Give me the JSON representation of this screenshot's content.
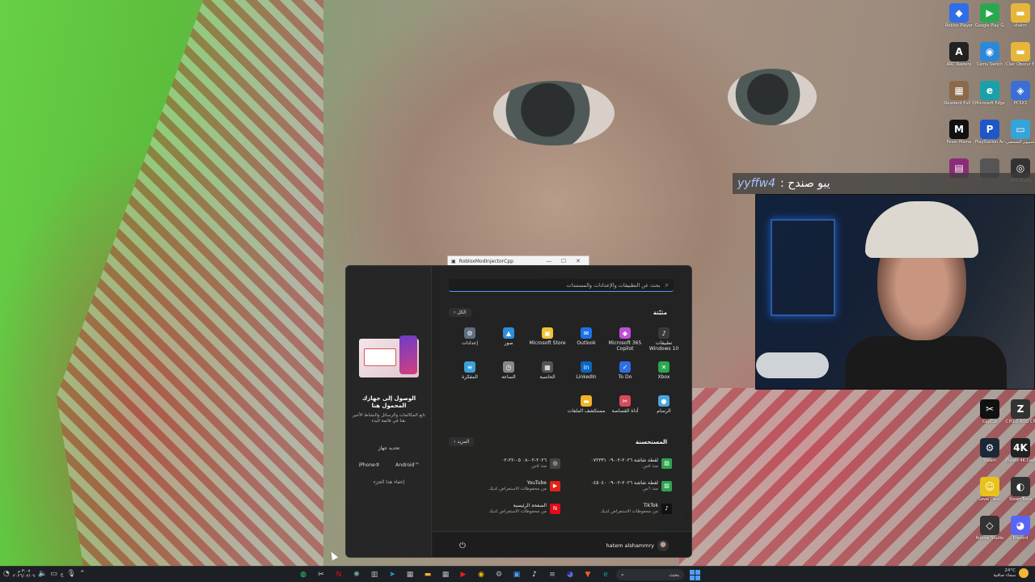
{
  "desktop_icons_right": [
    {
      "label": "Roblox Player",
      "icon": "roblox-icon",
      "color": "#2f6ee6"
    },
    {
      "label": "Google Play Games",
      "icon": "google-play-icon",
      "color": "#2aa84f"
    },
    {
      "label": "shatm",
      "icon": "folder-icon",
      "color": "#e5b63b"
    },
    {
      "label": "ARC Raiders",
      "icon": "arc-raiders-icon",
      "color": "#222222"
    },
    {
      "label": "Cemu Switch",
      "icon": "emulator-icon",
      "color": "#2c88d9"
    },
    {
      "label": "Clair Obscur Expedition 33",
      "icon": "folder-icon",
      "color": "#e5b63b"
    },
    {
      "label": "Resident Evil 7 Biohazard",
      "icon": "game-icon",
      "color": "#8a6a4a"
    },
    {
      "label": "Microsoft Edge",
      "icon": "edge-icon",
      "color": "#1aa0a8"
    },
    {
      "label": "PCSX2",
      "icon": "pcsx2-icon",
      "color": "#3b6fd6"
    },
    {
      "label": "Fever Meme",
      "icon": "fever-meme-icon",
      "color": "#111111"
    },
    {
      "label": "PlayStation Accessories",
      "icon": "playstation-icon",
      "color": "#1f56c9"
    },
    {
      "label": "هذا الكمبيوتر الشخصي",
      "icon": "computer-icon",
      "color": "#35a4d9"
    },
    {
      "label": "",
      "icon": "winrar-icon",
      "color": "#8a2c7a"
    },
    {
      "label": "",
      "icon": "",
      "color": "#555555"
    },
    {
      "label": "OBS Studio",
      "icon": "obs-icon",
      "color": "#333333"
    }
  ],
  "desktop_icons_right_lower": [
    {
      "label": "CapCut",
      "icon": "capcut-icon",
      "color": "#111111"
    },
    {
      "label": "CPUID ROG CPU-Z",
      "icon": "cpuz-icon",
      "color": "#333333"
    },
    {
      "label": "Steam",
      "icon": "steam-icon",
      "color": "#1b2838"
    },
    {
      "label": "Elgato 4K Capture",
      "icon": "elgato-icon",
      "color": "#222222"
    },
    {
      "label": "Level Devil",
      "icon": "level-devil-icon",
      "color": "#e8c21a"
    },
    {
      "label": "SteamTools",
      "icon": "steamtools-icon",
      "color": "#333333"
    },
    {
      "label": "Roblox Studio",
      "icon": "roblox-studio-icon",
      "color": "#333333"
    },
    {
      "label": "Discord",
      "icon": "discord-icon",
      "color": "#5865f2"
    }
  ],
  "donation": {
    "name": "yyffw4",
    "message": ": يبو صندح"
  },
  "mini_window": {
    "title": "RobloxModInjectorCpp",
    "minimize": "—",
    "maximize": "☐",
    "close": "✕"
  },
  "start_menu": {
    "search_placeholder": "بحث عن التطبيقات والإعدادات والمستندات",
    "pinned": {
      "title": "مثبّتة",
      "all_button": "الكل",
      "apps": [
        {
          "label": "تطبيقات Windows 10",
          "icon": "tiktok-icon",
          "color": "#3a3a3a"
        },
        {
          "label": "Microsoft 365 Copilot",
          "icon": "copilot-icon",
          "color": "#c14fd8"
        },
        {
          "label": "Outlook",
          "icon": "outlook-icon",
          "color": "#1a73e8"
        },
        {
          "label": "Microsoft Store",
          "icon": "store-icon",
          "color": "#f1c232"
        },
        {
          "label": "صور",
          "icon": "photos-icon",
          "color": "#2d8fdc"
        },
        {
          "label": "إعدادات",
          "icon": "settings-icon",
          "color": "#5f6f80"
        },
        {
          "label": "Xbox",
          "icon": "xbox-icon",
          "color": "#2aa84f"
        },
        {
          "label": "To Do",
          "icon": "todo-icon",
          "color": "#2f6ee6"
        },
        {
          "label": "LinkedIn",
          "icon": "linkedin-icon",
          "color": "#0a66c2"
        },
        {
          "label": "الحاسبة",
          "icon": "calculator-icon",
          "color": "#555555"
        },
        {
          "label": "الساعة",
          "icon": "clock-icon",
          "color": "#888888"
        },
        {
          "label": "المفكرة",
          "icon": "notepad-icon",
          "color": "#3aa0d8"
        },
        {
          "label": "الرسام",
          "icon": "paint-icon",
          "color": "#4ca3e0"
        },
        {
          "label": "أداة القصاصة",
          "icon": "snipping-tool-icon",
          "color": "#d84a5a"
        },
        {
          "label": "مستكشف الملفات",
          "icon": "file-explorer-icon",
          "color": "#f0b429"
        }
      ]
    },
    "recommended": {
      "title": "المستحسنة",
      "more_button": "المزيد",
      "items": [
        {
          "name": "لقطة شاشة ٢٠٢٦-٠٢-٠٩ ٠٧٢٣٣١",
          "sub": "منذ ٥س",
          "icon": "image-file-icon",
          "color": "#2ea44f"
        },
        {
          "name": "٢٠٢٦-٠٢-٠٨ ٠٥-٢٢-٠٢",
          "sub": "منذ ٥س",
          "icon": "obs-icon",
          "color": "#444444"
        },
        {
          "name": "لقطة شاشة ٢٠٢٦-٠٢-٠٩ ٠٤٥٠٤٠",
          "sub": "منذ ٦س",
          "icon": "image-file-icon",
          "color": "#2ea44f"
        },
        {
          "name": "YouTube",
          "sub": "من محفوظات الاستعراض لديك",
          "icon": "youtube-icon",
          "color": "#e62117"
        },
        {
          "name": "TikTok",
          "sub": "من محفوظات الاستعراض لديك",
          "icon": "tiktok-icon",
          "color": "#111111"
        },
        {
          "name": "الصفحة الرئيسية",
          "sub": "من محفوظات الاستعراض لديك",
          "icon": "netflix-icon",
          "color": "#e50914"
        }
      ]
    },
    "user_name": "hatem alshammry",
    "phone_pane": {
      "title": "الوصول إلى جهازك المحمول هنا",
      "description": "تابع المكالمات والرسائل والنشاط الأخير هنا في قائمة البدء.",
      "select_device": "تحديد جهاز",
      "iphone": "iPhone®",
      "android": "Android™",
      "hide": "إخفاء هذا الجزء"
    }
  },
  "taskbar": {
    "search_label": "بحث",
    "clock_time": "٣:٠٧ م",
    "clock_date": "٢٠٢٦/٠٢/٠٩",
    "lang": "ع",
    "weather_temp": "24°C",
    "weather_text": "سماء صافية",
    "apps": [
      {
        "icon": "whatsapp-icon",
        "color": "#25d366"
      },
      {
        "icon": "capcut-icon",
        "color": "#dddddd"
      },
      {
        "icon": "netflix-icon",
        "color": "#e50914"
      },
      {
        "icon": "chatgpt-icon",
        "color": "#74aa9c"
      },
      {
        "icon": "task-manager-icon",
        "color": "#bbbbbb"
      },
      {
        "icon": "telegram-icon",
        "color": "#2aa3e0"
      },
      {
        "icon": "calculator-icon",
        "color": "#bbbbbb"
      },
      {
        "icon": "file-explorer-icon",
        "color": "#f0b429"
      },
      {
        "icon": "calendar-icon",
        "color": "#bbbbbb"
      },
      {
        "icon": "youtube-icon",
        "color": "#e62117"
      },
      {
        "icon": "chrome-icon",
        "color": "#f4b400"
      },
      {
        "icon": "settings-icon",
        "color": "#bbbbbb"
      },
      {
        "icon": "store-icon",
        "color": "#4aa0ff"
      },
      {
        "icon": "tiktok-icon",
        "color": "#ffffff"
      },
      {
        "icon": "notepad-icon",
        "color": "#bbbbbb"
      },
      {
        "icon": "discord-icon",
        "color": "#5865f2"
      },
      {
        "icon": "brave-icon",
        "color": "#ff5a2c"
      },
      {
        "icon": "edge-icon",
        "color": "#1aa0a8"
      }
    ]
  }
}
